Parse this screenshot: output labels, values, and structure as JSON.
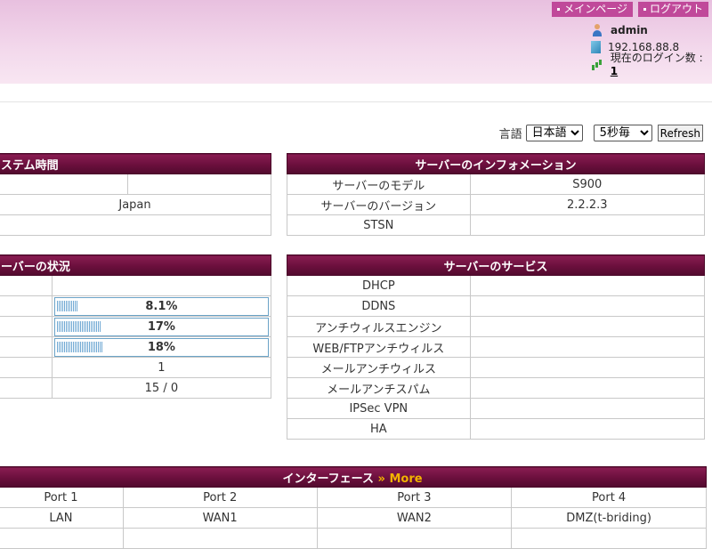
{
  "header": {
    "links": {
      "main_page": "メインページ",
      "logout": "ログアウト"
    },
    "user": {
      "name": "admin",
      "ip": "192.168.88.8",
      "login_count_label": "現在のログイン数 : ",
      "login_count": "1"
    }
  },
  "controls": {
    "language_label": "言語",
    "language_value": "日本語",
    "interval_value": "5秒毎",
    "refresh_label": "Refresh"
  },
  "system_time": {
    "title": "ステム時間",
    "timezone": "Japan"
  },
  "server_info": {
    "title": "サーバーのインフォメーション",
    "rows": [
      {
        "label": "サーバーのモデル",
        "value": "S900"
      },
      {
        "label": "サーバーのバージョン",
        "value": "2.2.2.3"
      },
      {
        "label": "STSN",
        "value": ""
      }
    ]
  },
  "server_status": {
    "title": "ーバーの状況",
    "usage": [
      {
        "text": "8.1%",
        "fraction": 0.081
      },
      {
        "text": "17%",
        "fraction": 0.17
      },
      {
        "text": "18%",
        "fraction": 0.18
      }
    ],
    "value_1": "1",
    "value_2": "15 / 0"
  },
  "server_services": {
    "title": "サーバーのサービス",
    "rows": [
      "DHCP",
      "DDNS",
      "アンチウィルスエンジン",
      "WEB/FTPアンチウィルス",
      "メールアンチウィルス",
      "メールアンチスパム",
      "IPSec VPN",
      "HA"
    ]
  },
  "interface": {
    "title": "インターフェース",
    "more_label": " » More",
    "ports": [
      "Port 1",
      "Port 2",
      "Port 3",
      "Port 4"
    ],
    "modes": [
      "LAN",
      "WAN1",
      "WAN2",
      "DMZ(t-briding)"
    ]
  }
}
